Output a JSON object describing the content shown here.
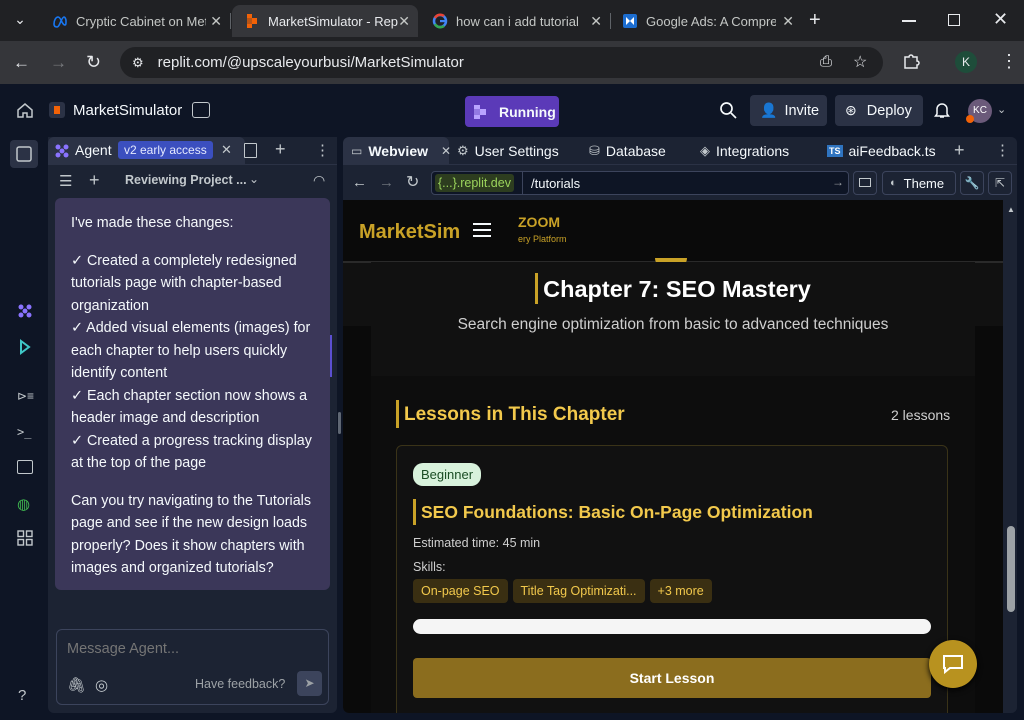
{
  "browser": {
    "tabs": [
      {
        "title": "Cryptic Cabinet on Met",
        "close": "✕"
      },
      {
        "title": "MarketSimulator - Rep",
        "close": "✕"
      },
      {
        "title": "how can i add tutorial",
        "close": "✕"
      },
      {
        "title": "Google Ads: A Compre",
        "close": "✕"
      }
    ],
    "new_tab": "+",
    "url": "replit.com/@upscaleyourbusi/MarketSimulator",
    "profile_initial": "K"
  },
  "replit": {
    "project_name": "MarketSimulator",
    "run_status": "Running",
    "invite_label": "Invite",
    "deploy_label": "Deploy",
    "avatar_initials": "KC"
  },
  "agent": {
    "tab_label": "Agent",
    "badge": "v2 early access",
    "thread_title": "Reviewing Project ...",
    "message": {
      "intro": "I've made these changes:",
      "items": [
        "✓ Created a completely redesigned tutorials page with chapter-based organization",
        "✓ Added visual elements (images) for each chapter to help users quickly identify content",
        "✓ Each chapter section now shows a header image and description",
        "✓ Created a progress tracking display at the top of the page"
      ],
      "question": "Can you try navigating to the Tutorials page and see if the new design loads properly? Does it show chapters with images and organized tutorials?"
    },
    "input_placeholder": "Message Agent...",
    "feedback_label": "Have feedback?"
  },
  "webview": {
    "tabs": [
      "Webview",
      "User Settings",
      "Database",
      "Integrations",
      "aiFeedback.ts"
    ],
    "domain_label": "{...}.replit.dev",
    "path": "/tutorials",
    "theme_label": "Theme",
    "site": {
      "logo": "MarketSim",
      "logo_partial": "ZOOM",
      "logo_sub": "ery Platform",
      "chapter_title": "Chapter 7: SEO Mastery",
      "chapter_desc": "Search engine optimization from basic to advanced techniques",
      "lessons_heading": "Lessons in This Chapter",
      "lesson_count": "2 lessons",
      "lesson": {
        "level": "Beginner",
        "title": "SEO Foundations: Basic On-Page Optimization",
        "time": "Estimated time: 45 min",
        "skills_label": "Skills:",
        "skills": [
          "On-page SEO",
          "Title Tag Optimizati...",
          "+3 more"
        ],
        "progress": 0,
        "cta": "Start Lesson"
      }
    }
  }
}
